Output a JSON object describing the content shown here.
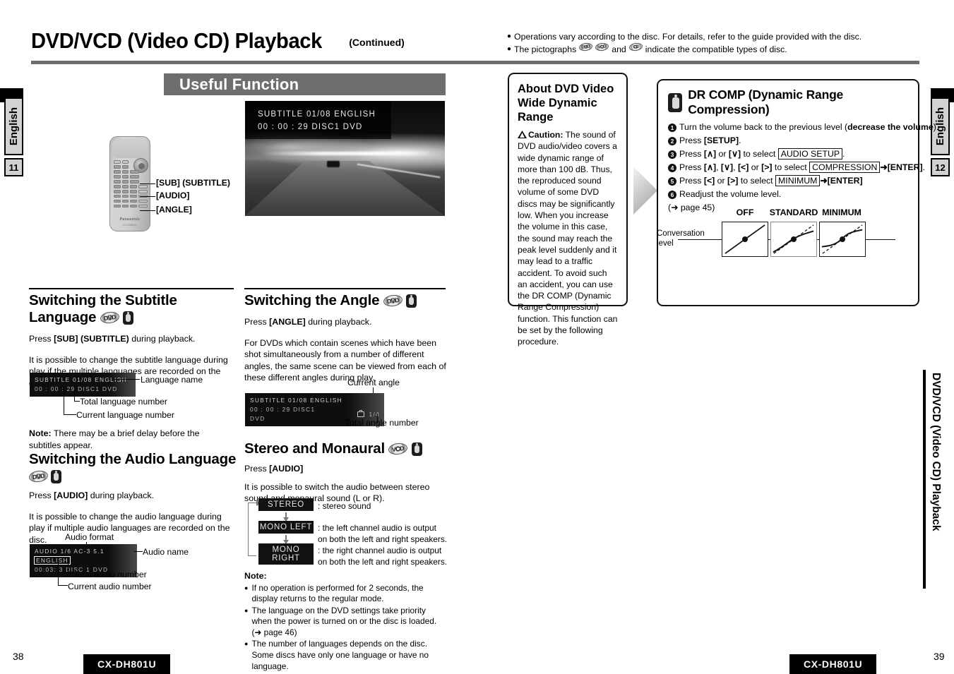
{
  "header": {
    "title": "DVD/VCD (Video CD) Playback",
    "continued": "(Continued)",
    "notes": [
      "Operations vary according to the disc. For details, refer to the guide provided with the disc.",
      "The pictographs",
      "and",
      "indicate the compatible types of disc."
    ]
  },
  "edges": {
    "left_tab": "English",
    "left_page": "11",
    "right_tab": "English",
    "right_page": "12",
    "side_chapter": "DVD/VCD (Video CD) Playback"
  },
  "banner": {
    "useful_function": "Useful Function"
  },
  "remote": {
    "brand": "Panasonic",
    "model": "CX-DH801U",
    "callouts": [
      "[SUB] (SUBTITLE)",
      "[AUDIO]",
      "[ANGLE]"
    ]
  },
  "osd_photo": {
    "line1": "SUBTITLE  01/08  ENGLISH",
    "line2": "00 : 00 : 29    DISC1  DVD"
  },
  "subtitle_section": {
    "heading": "Switching the Subtitle Language",
    "discs": [
      "DVD",
      "remote"
    ],
    "press": "Press [SUB] (SUBTITLE) during playback.",
    "press_bold": "[SUB] (SUBTITLE)",
    "body": "It is possible to change the subtitle language during play if the multiple languages are recorded on the disc.",
    "osd": {
      "line1": "SUBTITLE  01/08  ENGLISH",
      "line2": "00 : 00 : 29   DISC1  DVD"
    },
    "callouts": {
      "language_name": "Language name",
      "total": "Total language number",
      "current": "Current language number"
    },
    "note_label": "Note:",
    "note": "There may be a brief delay before the subtitles appear."
  },
  "audio_section": {
    "heading": "Switching the Audio Language",
    "press": "Press [AUDIO] during playback.",
    "press_bold": "[AUDIO]",
    "body": "It is possible to change the audio language during play if multiple audio languages are recorded on the disc.",
    "osd": {
      "line1a": "AUDIO  1/6  AC-3 5.1",
      "line1b": "ENGLISH",
      "line2": "00:03: 3   DISC 1   DVD"
    },
    "callouts": {
      "audio_format": "Audio format",
      "audio_name": "Audio name",
      "total": "Total audio number",
      "current": "Current audio number"
    }
  },
  "angle_section": {
    "heading": "Switching the Angle",
    "press": "Press [ANGLE] during playback.",
    "press_bold": "[ANGLE]",
    "body": "For DVDs which contain scenes which have been shot simultaneously from a number of different angles, the same scene can be viewed from each of these different angles during play.",
    "osd": {
      "line1": "SUBTITLE  01/08  ENGLISH",
      "line2": "00 : 00 : 29   DISC1  DVD",
      "angle": "1/4"
    },
    "callouts": {
      "current_angle": "Current angle",
      "total_angle": "Total angle number"
    }
  },
  "stereo_section": {
    "heading": "Stereo and Monaural",
    "press": "Press [AUDIO]",
    "press_bold": "[AUDIO]",
    "body": "It is possible to switch the audio between stereo sound and monaural sound (L or R).",
    "modes": [
      {
        "label": "STEREO",
        "desc": ": stereo sound"
      },
      {
        "label": "MONO LEFT",
        "desc": ": the left channel audio is output on both the left and right speakers."
      },
      {
        "label": "MONO RIGHT",
        "desc": ": the right channel audio is output on both the left and right speakers."
      }
    ],
    "note_label": "Note:",
    "notes": [
      "If no operation is performed for 2 seconds, the display returns to the regular mode.",
      "The language on the DVD settings take priority when the power is turned on or the disc is loaded. (➜ page 46)",
      "The number of languages depends on the disc. Some discs have only one language or have no language."
    ]
  },
  "about_box": {
    "heading": "About DVD Video Wide Dynamic Range",
    "caution_label": "Caution:",
    "text": "The sound of DVD audio/video covers a wide dynamic range of more than 100 dB. Thus, the reproduced sound volume of some DVD discs may be significantly low. When you increase the volume in this case, the sound may reach the peak level suddenly and it may lead to a traffic accident. To avoid such an accident, you can use the DR COMP (Dynamic Range Compression) function. This function can be set by the following procedure."
  },
  "drcomp_box": {
    "title": "DR COMP (Dynamic Range Compression)",
    "steps": [
      {
        "n": "1",
        "parts": [
          "Turn the volume back to the previous level (",
          "decrease the volume",
          ")."
        ]
      },
      {
        "n": "2",
        "parts": [
          "Press ",
          "[SETUP]",
          "."
        ]
      },
      {
        "n": "3",
        "parts": [
          "Press ",
          "[∧]",
          " or ",
          "[∨]",
          " to select ",
          "AUDIO SETUP",
          "."
        ]
      },
      {
        "n": "4",
        "parts": [
          "Press ",
          "[∧]",
          ", ",
          "[∨]",
          ", ",
          "[<]",
          " or ",
          "[>]",
          " to select ",
          "COMPRESSION",
          " ➜ ",
          "[ENTER]",
          "."
        ]
      },
      {
        "n": "5",
        "parts": [
          "Press ",
          "[<]",
          " or ",
          "[>]",
          " to select ",
          "MINIMUM",
          " ➜ ",
          "[ENTER]"
        ]
      },
      {
        "n": "6",
        "parts": [
          "Readjust the volume level."
        ]
      }
    ],
    "page_ref": "(➜ page 45)",
    "graphs": {
      "labels": [
        "OFF",
        "STANDARD",
        "MINIMUM"
      ],
      "conversation_label": "Conversation level"
    }
  },
  "footer": {
    "left_page": "38",
    "right_page": "39",
    "model_left": "CX-DH801U",
    "model_right": "CX-DH801U"
  }
}
